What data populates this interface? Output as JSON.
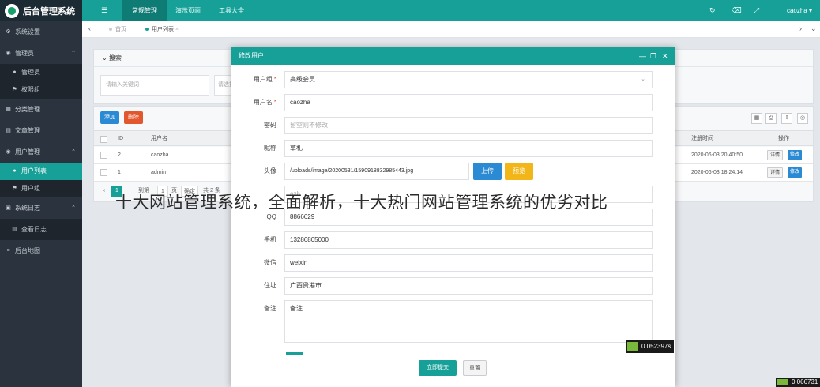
{
  "brand": {
    "title": "后台管理系统"
  },
  "topbar": {
    "menu_icon": "☰",
    "nav": [
      {
        "label": "常规管理",
        "active": true
      },
      {
        "label": "演示页面",
        "active": false
      },
      {
        "label": "工具大全",
        "active": false
      }
    ],
    "refresh_icon": "↻",
    "trash_icon": "⌫",
    "fullscreen_icon": "⤢",
    "user": "caozha ▾"
  },
  "sidebar": {
    "items": [
      {
        "label": "系统设置",
        "icon": "⚙"
      },
      {
        "label": "管理员",
        "icon": "◉",
        "chevron": "⌃"
      },
      {
        "label": "管理员",
        "icon": "●",
        "sub": true
      },
      {
        "label": "权限组",
        "icon": "⚑",
        "sub": true
      },
      {
        "label": "分类管理",
        "icon": "▦"
      },
      {
        "label": "文章管理",
        "icon": "▤"
      },
      {
        "label": "用户管理",
        "icon": "◉",
        "chevron": "⌃"
      },
      {
        "label": "用户列表",
        "icon": "●",
        "sub": true,
        "active": true
      },
      {
        "label": "用户组",
        "icon": "⚑",
        "sub": true
      },
      {
        "label": "系统日志",
        "icon": "▣",
        "chevron": "⌃"
      },
      {
        "label": "查看日志",
        "icon": "▤",
        "sub": true
      },
      {
        "label": "后台地图",
        "icon": "≡"
      }
    ]
  },
  "tabs": {
    "prev": "‹",
    "home": "首页",
    "current": "用户列表",
    "current_close": "×",
    "next": "›",
    "close_all": "⌄"
  },
  "search": {
    "heading": "⌄ 搜索",
    "keyword_placeholder": "请输入关键词",
    "select_placeholder": "请选择"
  },
  "table": {
    "add_label": "添加",
    "delete_label": "删除",
    "tool_icons": [
      "▦",
      "⎙",
      "⇩",
      "◎"
    ],
    "headers": {
      "id": "ID",
      "username": "用户名",
      "reg_time": "注册时间",
      "actions": "操作"
    },
    "rows": [
      {
        "id": "2",
        "username": "caozha",
        "reg_time": "2020-06-03 20:40:50",
        "detail": "详情",
        "edit": "修改"
      },
      {
        "id": "1",
        "username": "admin",
        "reg_time": "2020-06-03 18:24:14",
        "detail": "详情",
        "edit": "修改"
      }
    ],
    "pager": {
      "prev": "‹",
      "page": "1",
      "goto": "到第",
      "page_input": "1",
      "unit": "页",
      "confirm": "确定",
      "total": "共 2 条"
    }
  },
  "modal": {
    "title": "修改用户",
    "min_icon": "—",
    "max_icon": "❐",
    "close_icon": "✕",
    "fields": {
      "group_label": "用户组",
      "group_value": "高级会员",
      "username_label": "用户名",
      "username_value": "caozha",
      "password_label": "密码",
      "password_placeholder": "留空则不修改",
      "nickname_label": "昵称",
      "nickname_value": "草札",
      "avatar_label": "头像",
      "avatar_value": "/uploads/image/20200531/1590918832985443.jpg",
      "upload_label": "上传",
      "preview_label": "预览",
      "email_value": "ozh",
      "qq_label": "QQ",
      "qq_value": "8866629",
      "mobile_label": "手机",
      "mobile_value": "13286805000",
      "wechat_label": "微信",
      "wechat_value": "weixin",
      "address_label": "住址",
      "address_value": "广西贵港市",
      "remark_label": "备注",
      "remark_value": "备注",
      "required_mark": "*"
    },
    "submit_label": "立即提交",
    "reset_label": "重置"
  },
  "watermark": "十大网站管理系统，全面解析，十大热门网站管理系统的优劣对比",
  "timings": [
    "0.052397s",
    "0.066731"
  ]
}
